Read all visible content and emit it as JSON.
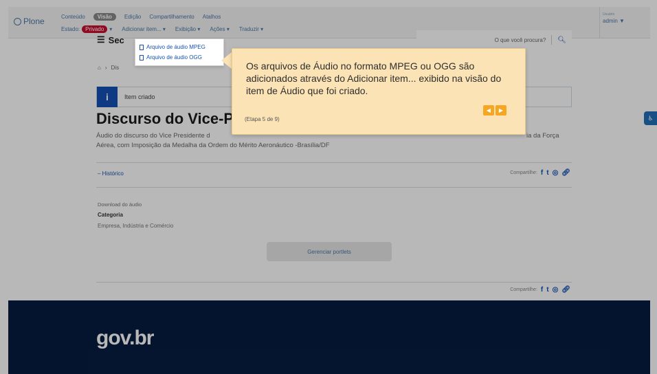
{
  "toolbar": {
    "logo": "Plone",
    "tabs": [
      "Conteúdo",
      "Visão",
      "Edição",
      "Compartilhamento",
      "Atalhos"
    ],
    "active_tab": "Visão",
    "estado_label": "Estado:",
    "estado_value": "Privado",
    "actions": [
      "Adicionar item...",
      "Exibição",
      "Ações",
      "Traduzir"
    ],
    "user_label": "Usuário",
    "user_name": "admin"
  },
  "dropdown": {
    "items": [
      "Arquivo de áudio MPEG",
      "Arquivo de áudio OGG"
    ]
  },
  "header": {
    "section": "Sec",
    "search_placeholder": "O que você procura?"
  },
  "breadcrumb": "Dis",
  "status": {
    "message": "Item criado"
  },
  "page": {
    "title": "Discurso do Vice-Pr",
    "description_line1": "Áudio do discurso do Vice Presidente d",
    "description_line1_end": "ia da Força",
    "description_line2": "Aérea, com Imposição da Medalha da Ordem do Mérito Aeronáutico -Brasília/DF",
    "historico": "– Histórico",
    "share_label": "Compartilhe:",
    "download": "Download do áudio",
    "category_label": "Categoria",
    "category_value": "Empresa, Indústria e Comércio",
    "portlets_button": "Gerenciar portlets"
  },
  "footer": {
    "logo": "gov.br"
  },
  "tour": {
    "text": "Os arquivos de Áudio no formato MPEG ou OGG são adicionados através do Adicionar item... exibido na visão do item de Áudio que foi criado.",
    "step": "(Etapa 5 de 9)"
  }
}
